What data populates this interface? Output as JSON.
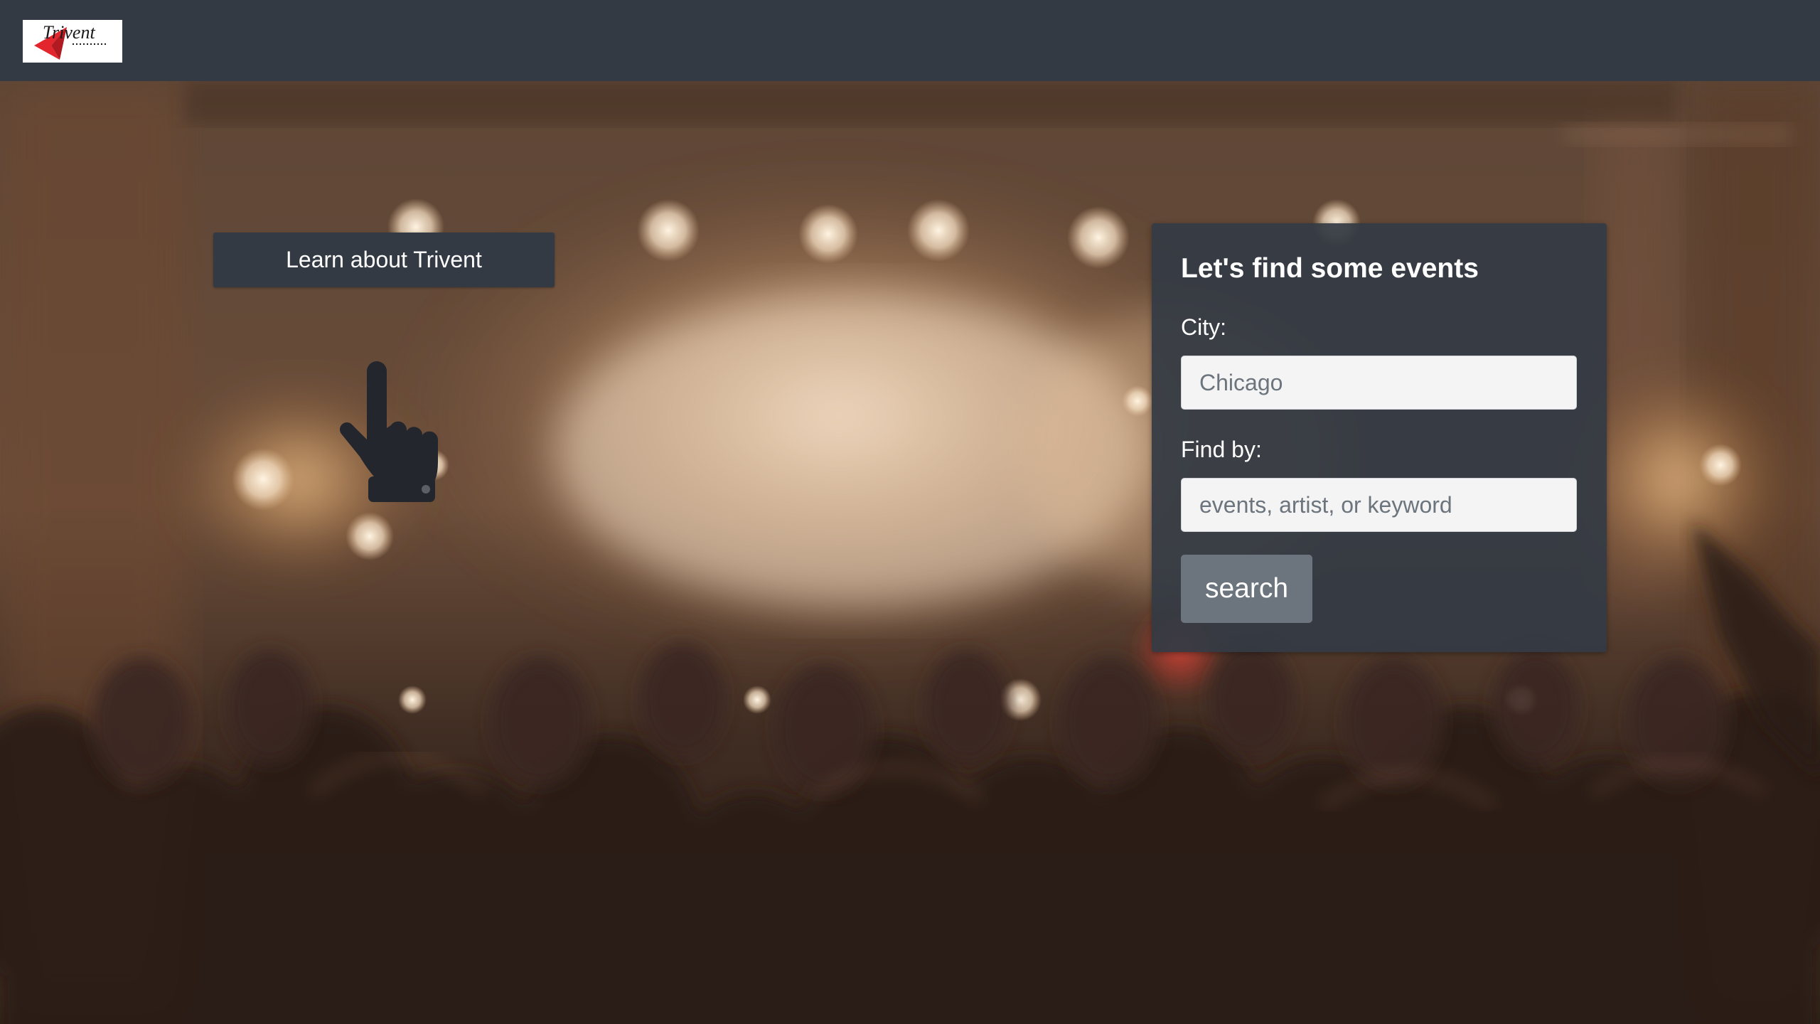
{
  "navbar": {
    "logo_text": "Trivent",
    "logo_icon": "trivent-logo-icon",
    "background_color": "#343a44"
  },
  "hero": {
    "learn_button_label": "Learn about Trivent",
    "pointer_icon": "hand-pointing-up-icon"
  },
  "search_card": {
    "title": "Let's find some events",
    "city_label": "City:",
    "city_placeholder": "Chicago",
    "find_label": "Find by:",
    "find_placeholder": "events, artist, or keyword",
    "search_button_label": "search",
    "button_color": "#6c757d"
  }
}
